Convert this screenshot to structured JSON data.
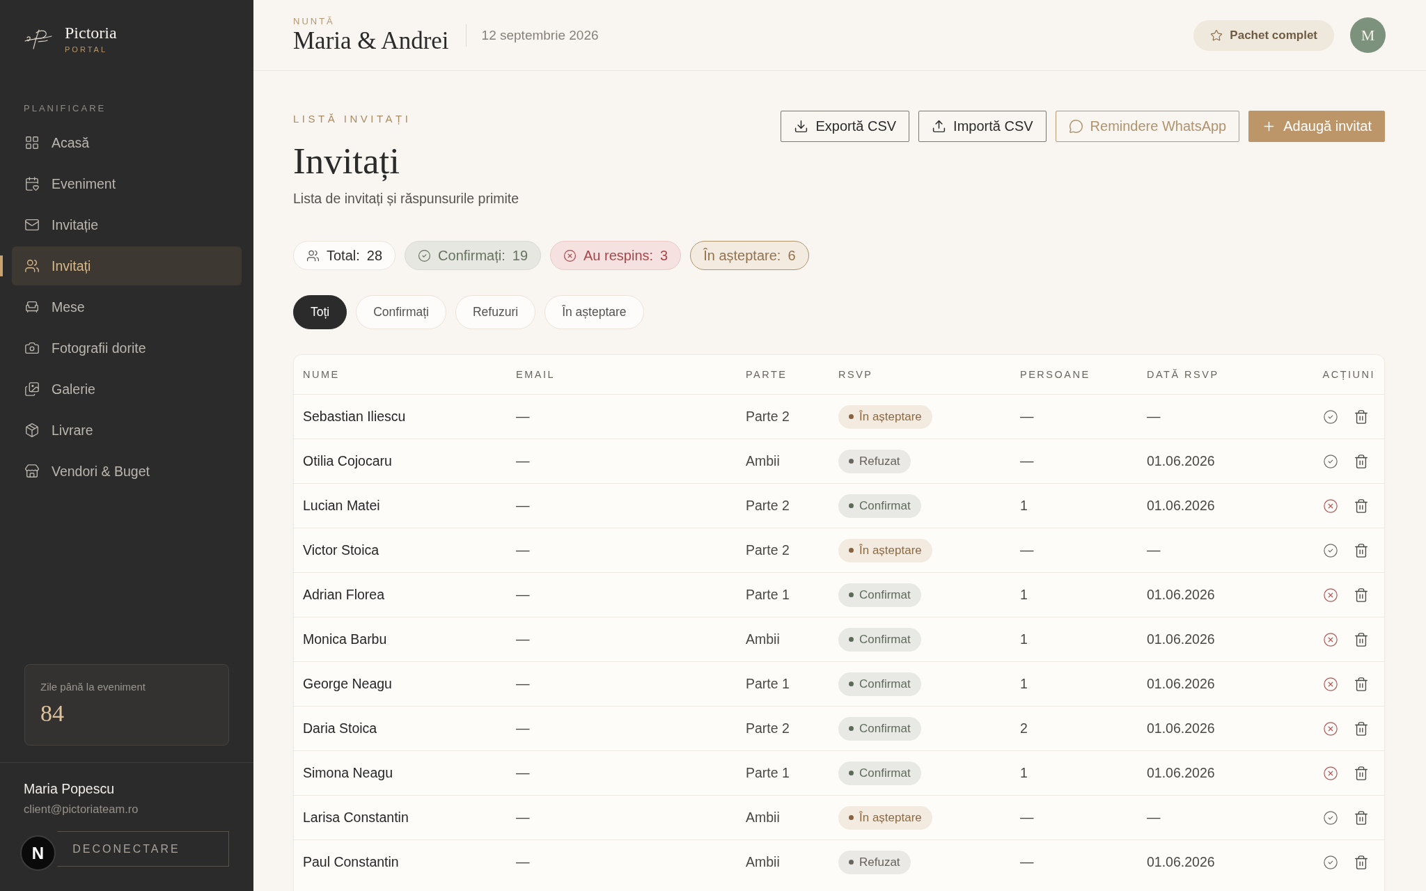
{
  "sidebar": {
    "brand": {
      "name": "Pictoria",
      "tagline": "PORTAL"
    },
    "section_label": "PLANIFICARE",
    "items": [
      {
        "label": "Acasă",
        "selected": false
      },
      {
        "label": "Eveniment",
        "selected": false
      },
      {
        "label": "Invitație",
        "selected": false
      },
      {
        "label": "Invitați",
        "selected": true
      },
      {
        "label": "Mese",
        "selected": false
      },
      {
        "label": "Fotografii dorite",
        "selected": false
      },
      {
        "label": "Galerie",
        "selected": false
      },
      {
        "label": "Livrare",
        "selected": false
      },
      {
        "label": "Vendori & Buget",
        "selected": false
      }
    ],
    "countdown": {
      "label": "Zile până la eveniment",
      "value": "84"
    },
    "user": {
      "name": "Maria Popescu",
      "email": "client@pictoriateam.ro"
    },
    "logout_button": "DECONECTARE"
  },
  "dev_indicator": {
    "glyph": "N"
  },
  "header": {
    "eyebrow": "NUNTĂ",
    "title": "Maria & Andrei",
    "date": "12 septembrie 2026",
    "package": "Pachet complet",
    "avatar": "M"
  },
  "page": {
    "eyebrow": "LISTĂ INVITAȚI",
    "title": "Invitați",
    "subtitle": "Lista de invitați și răspunsurile primite",
    "actions": [
      {
        "kind": "export",
        "label": "Exportă CSV"
      },
      {
        "kind": "import",
        "label": "Importă CSV"
      },
      {
        "kind": "whatsapp",
        "label": "Remindere WhatsApp"
      },
      {
        "kind": "add",
        "label": "Adaugă invitat"
      }
    ],
    "stats": [
      {
        "kind": "total",
        "label": "Total:",
        "count": "28"
      },
      {
        "kind": "confirmed",
        "label": "Confirmați:",
        "count": "19"
      },
      {
        "kind": "declined",
        "label": "Au respins:",
        "count": "3"
      },
      {
        "kind": "pending",
        "label": "În așteptare:",
        "count": "6"
      }
    ],
    "filters": [
      {
        "label": "Toți",
        "selected": true
      },
      {
        "label": "Confirmați",
        "selected": false
      },
      {
        "label": "Refuzuri",
        "selected": false
      },
      {
        "label": "În așteptare",
        "selected": false
      }
    ]
  },
  "table": {
    "columns": [
      "NUME",
      "EMAIL",
      "PARTE",
      "RSVP",
      "PERSOANE",
      "DATĂ RSVP",
      "ACȚIUNI"
    ],
    "rows": [
      {
        "name": "Sebastian Iliescu",
        "email": "—",
        "side": "Parte 2",
        "rsvp": {
          "kind": "pending",
          "label": "În așteptare"
        },
        "persons": "—",
        "rsvp_date": "—"
      },
      {
        "name": "Otilia Cojocaru",
        "email": "—",
        "side": "Ambii",
        "rsvp": {
          "kind": "refused",
          "label": "Refuzat"
        },
        "persons": "—",
        "rsvp_date": "01.06.2026"
      },
      {
        "name": "Lucian Matei",
        "email": "—",
        "side": "Parte 2",
        "rsvp": {
          "kind": "confirmed",
          "label": "Confirmat"
        },
        "persons": "1",
        "rsvp_date": "01.06.2026"
      },
      {
        "name": "Victor Stoica",
        "email": "—",
        "side": "Parte 2",
        "rsvp": {
          "kind": "pending",
          "label": "În așteptare"
        },
        "persons": "—",
        "rsvp_date": "—"
      },
      {
        "name": "Adrian Florea",
        "email": "—",
        "side": "Parte 1",
        "rsvp": {
          "kind": "confirmed",
          "label": "Confirmat"
        },
        "persons": "1",
        "rsvp_date": "01.06.2026"
      },
      {
        "name": "Monica Barbu",
        "email": "—",
        "side": "Ambii",
        "rsvp": {
          "kind": "confirmed",
          "label": "Confirmat"
        },
        "persons": "1",
        "rsvp_date": "01.06.2026"
      },
      {
        "name": "George Neagu",
        "email": "—",
        "side": "Parte 1",
        "rsvp": {
          "kind": "confirmed",
          "label": "Confirmat"
        },
        "persons": "1",
        "rsvp_date": "01.06.2026"
      },
      {
        "name": "Daria Stoica",
        "email": "—",
        "side": "Parte 2",
        "rsvp": {
          "kind": "confirmed",
          "label": "Confirmat"
        },
        "persons": "2",
        "rsvp_date": "01.06.2026"
      },
      {
        "name": "Simona Neagu",
        "email": "—",
        "side": "Parte 1",
        "rsvp": {
          "kind": "confirmed",
          "label": "Confirmat"
        },
        "persons": "1",
        "rsvp_date": "01.06.2026"
      },
      {
        "name": "Larisa Constantin",
        "email": "—",
        "side": "Ambii",
        "rsvp": {
          "kind": "pending",
          "label": "În așteptare"
        },
        "persons": "—",
        "rsvp_date": "—"
      },
      {
        "name": "Paul Constantin",
        "email": "—",
        "side": "Ambii",
        "rsvp": {
          "kind": "refused",
          "label": "Refuzat"
        },
        "persons": "—",
        "rsvp_date": "01.06.2026"
      }
    ]
  }
}
